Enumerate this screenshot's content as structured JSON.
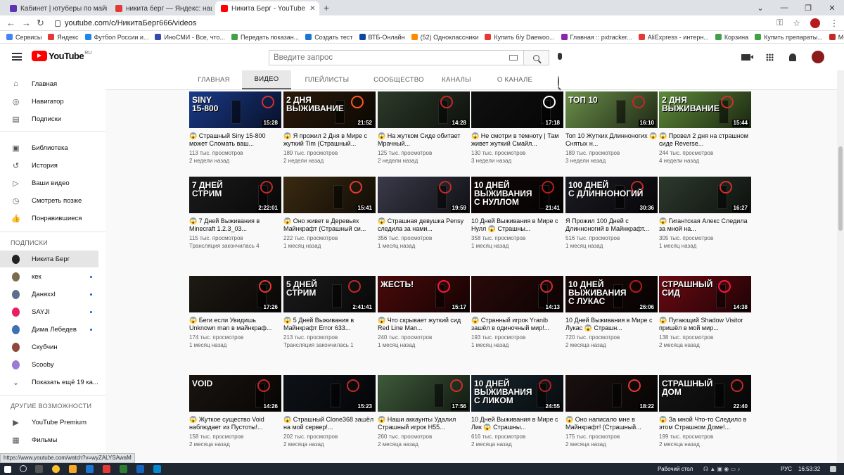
{
  "browser": {
    "tabs": [
      {
        "title": "Кабинет | ютуберы по майнкрафт"
      },
      {
        "title": "никита берг — Яндекс: нашлось"
      },
      {
        "title": "Никита Берг - YouTube"
      }
    ],
    "new_tab": "+",
    "url": "youtube.com/c/НикитаБерг666/videos",
    "bookmarks": [
      {
        "label": "Сервисы",
        "color": "#4285f4"
      },
      {
        "label": "Яндекс",
        "color": "#e53935"
      },
      {
        "label": "Футбол России и...",
        "color": "#1e88e5"
      },
      {
        "label": "ИноСМИ - Все, что...",
        "color": "#3949ab"
      },
      {
        "label": "Передать показан...",
        "color": "#43a047"
      },
      {
        "label": "Создать тест",
        "color": "#1976d2"
      },
      {
        "label": "ВТБ-Онлайн",
        "color": "#0d47a1"
      },
      {
        "label": "(52) Одноклассники",
        "color": "#fb8c00"
      },
      {
        "label": "Купить б/у Daewoo...",
        "color": "#e53935"
      },
      {
        "label": "Главная :: pxtracker...",
        "color": "#8e24aa"
      },
      {
        "label": "AliExpress - интерн...",
        "color": "#e53935"
      },
      {
        "label": "Корзина",
        "color": "#43a047"
      },
      {
        "label": "Купить препараты...",
        "color": "#43a047"
      },
      {
        "label": "Моя учетная запис...",
        "color": "#c62828"
      }
    ]
  },
  "header": {
    "logo": "YouTube",
    "logo_region": "RU",
    "search_placeholder": "Введите запрос"
  },
  "sidebar": {
    "main": [
      {
        "label": "Главная",
        "icon": "home-icon",
        "glyph": "⌂"
      },
      {
        "label": "Навигатор",
        "icon": "compass-icon",
        "glyph": "◎"
      },
      {
        "label": "Подписки",
        "icon": "subscriptions-icon",
        "glyph": "▤"
      }
    ],
    "library": [
      {
        "label": "Библиотека",
        "icon": "library-icon",
        "glyph": "▣"
      },
      {
        "label": "История",
        "icon": "history-icon",
        "glyph": "↺"
      },
      {
        "label": "Ваши видео",
        "icon": "your-videos-icon",
        "glyph": "▷"
      },
      {
        "label": "Смотреть позже",
        "icon": "watch-later-icon",
        "glyph": "◷"
      },
      {
        "label": "Понравившиеся",
        "icon": "like-icon",
        "glyph": "👍"
      }
    ],
    "subs_heading": "ПОДПИСКИ",
    "subs": [
      {
        "label": "Никита Берг",
        "color": "#222",
        "dot": false,
        "selected": true
      },
      {
        "label": "кек",
        "color": "#7a6a4f",
        "dot": true
      },
      {
        "label": "Даняxxl",
        "color": "#5b6f8a",
        "dot": true
      },
      {
        "label": "SAYJI",
        "color": "#e91e63",
        "dot": true
      },
      {
        "label": "Дима Лебедев",
        "color": "#3f6fb5",
        "dot": true
      },
      {
        "label": "Скубчин",
        "color": "#8d4a3a",
        "dot": false
      },
      {
        "label": "Scooby",
        "color": "#9c7bd6",
        "dot": false
      }
    ],
    "show_more": "Показать ещё 19 ка...",
    "other_heading": "ДРУГИЕ ВОЗМОЖНОСТИ",
    "other": [
      {
        "label": "YouTube Premium",
        "icon": "youtube-premium-icon",
        "glyph": "▶"
      },
      {
        "label": "Фильмы",
        "icon": "films-icon",
        "glyph": "▦"
      }
    ]
  },
  "channel_tabs": [
    {
      "label": "ГЛАВНАЯ"
    },
    {
      "label": "ВИДЕО",
      "selected": true
    },
    {
      "label": "ПЛЕЙЛИСТЫ"
    },
    {
      "label": "СООБЩЕСТВО"
    },
    {
      "label": "КАНАЛЫ"
    },
    {
      "label": "О КАНАЛЕ"
    }
  ],
  "videos": [
    {
      "title": "😱 Страшный Siny 15-800 может Сломать ваш...",
      "views": "113 тыс. просмотров",
      "age": "2 недели назад",
      "duration": "15:28",
      "overlay": "SINY\n15-800",
      "bg": "#1a3a8a",
      "accent": "#d32f2f"
    },
    {
      "title": "😱 Я прожил 2 Дня в Мире с жуткий Tim (Страшный...",
      "views": "189 тыс. просмотров",
      "age": "2 недели назад",
      "duration": "21:52",
      "overlay": "2 ДНЯ\nВЫЖИВАНИЕ",
      "bg": "#2a1a0a",
      "accent": "#ff5722"
    },
    {
      "title": "😱 На жутком Сиде обитает Мрачный...",
      "views": "125 тыс. просмотров",
      "age": "2 недели назад",
      "duration": "14:28",
      "overlay": "",
      "bg": "#2d3a2a",
      "accent": "#c62828"
    },
    {
      "title": "😱 Не смотри в темноту | Там живет жуткий Смайл...",
      "views": "130 тыс. просмотров",
      "age": "3 недели назад",
      "duration": "17:18",
      "overlay": "",
      "bg": "#111111",
      "accent": "#ffffff"
    },
    {
      "title": "Топ 10 Жутких Длинноногих 😱 Снятых н...",
      "views": "189 тыс. просмотров",
      "age": "3 недели назад",
      "duration": "16:10",
      "overlay": "ТОП 10",
      "bg": "#6b8f4a",
      "accent": "#c62828"
    },
    {
      "title": "😱 Провел 2 дня на страшном сиде Reverse...",
      "views": "244 тыс. просмотров",
      "age": "4 недели назад",
      "duration": "15:44",
      "overlay": "2 ДНЯ\nВЫЖИВАНИЕ",
      "bg": "#5e8a3a",
      "accent": "#d32f2f"
    },
    {
      "title": "😱 7 Дней Выживания в Minecraft 1.2.3_03...",
      "views": "115 тыс. просмотров",
      "age": "Трансляция закончилась 4",
      "duration": "2:22:01",
      "overlay": "7 ДНЕЙ\nСТРИМ",
      "bg": "#1b1b1b",
      "accent": "#c62828"
    },
    {
      "title": "😱 Оно живет в Деревьях Майнкрафт (Страшный си...",
      "views": "222 тыс. просмотров",
      "age": "1 месяц назад",
      "duration": "15:41",
      "overlay": "",
      "bg": "#3a2a12",
      "accent": "#e53935"
    },
    {
      "title": "😱 Страшная девушка Pensy следила за нами...",
      "views": "356 тыс. просмотров",
      "age": "1 месяц назад",
      "duration": "19:59",
      "overlay": "",
      "bg": "#3a3a4a",
      "accent": "#c62828"
    },
    {
      "title": "10 Дней Выживания в Мире с Нулл 😱 Страшны...",
      "views": "358 тыс. просмотров",
      "age": "1 месяц назад",
      "duration": "21:41",
      "overlay": "10 ДНЕЙ\nВЫЖИВАНИЯ\nС НУЛЛОМ",
      "bg": "#120808",
      "accent": "#b71c1c"
    },
    {
      "title": "Я Прожил 100 Дней с Длинноногий в Майнкрафт...",
      "views": "516 тыс. просмотров",
      "age": "1 месяц назад",
      "duration": "30:36",
      "overlay": "100 ДНЕЙ\nС ДЛИННОНОГИЙ",
      "bg": "#1a1a22",
      "accent": "#c62828"
    },
    {
      "title": "😱 Гигантская Алекс Следила за мной на...",
      "views": "305 тыс. просмотров",
      "age": "1 месяц назад",
      "duration": "16:27",
      "overlay": "",
      "bg": "#2e3a2e",
      "accent": "#d32f2f"
    },
    {
      "title": "😱 Беги если Увидишь Unknown man в майнкраф...",
      "views": "174 тыс. просмотров",
      "age": "1 месяц назад",
      "duration": "17:26",
      "overlay": "",
      "bg": "#1e1a14",
      "accent": "#e53935"
    },
    {
      "title": "😱 5 Дней Выживания в Майнкрафт Error 633...",
      "views": "213 тыс. просмотров",
      "age": "Трансляция закончилась 1",
      "duration": "2:41:41",
      "overlay": "5 ДНЕЙ\nСТРИМ",
      "bg": "#1b1b1b",
      "accent": "#c62828"
    },
    {
      "title": "😱 Что скрывает жуткий сид Red Line Man...",
      "views": "240 тыс. просмотров",
      "age": "1 месяц назад",
      "duration": "15:17",
      "overlay": "ЖЕСТЬ!",
      "bg": "#4a0a0a",
      "accent": "#ff1744"
    },
    {
      "title": "😱 Странный игрок Yranib зашёл в одиночный мир!...",
      "views": "193 тыс. просмотров",
      "age": "1 месяц назад",
      "duration": "14:13",
      "overlay": "",
      "bg": "#2a0a0a",
      "accent": "#d32f2f"
    },
    {
      "title": "10 Дней Выживания в Мире с Лукас 😱 Страшн...",
      "views": "720 тыс. просмотров",
      "age": "2 месяца назад",
      "duration": "26:06",
      "overlay": "10 ДНЕЙ\nВЫЖИВАНИЯ\nС ЛУКАС",
      "bg": "#1a0808",
      "accent": "#b71c1c"
    },
    {
      "title": "😱 Пугающий Shadow Visitor пришёл в мой мир...",
      "views": "138 тыс. просмотров",
      "age": "2 месяца назад",
      "duration": "14:38",
      "overlay": "СТРАШНЫЙ\nСИД",
      "bg": "#6a0a12",
      "accent": "#ff1744"
    },
    {
      "title": "😱 Жуткое существо Void наблюдает из Пустоты!...",
      "views": "158 тыс. просмотров",
      "age": "2 месяца назад",
      "duration": "14:26",
      "overlay": "VOID",
      "bg": "#1a1410",
      "accent": "#c62828"
    },
    {
      "title": "😱 Страшный Clone368 зашёл на мой сервер!...",
      "views": "202 тыс. просмотров",
      "age": "2 месяца назад",
      "duration": "15:23",
      "overlay": "",
      "bg": "#0e1218",
      "accent": "#c62828"
    },
    {
      "title": "😱 Наши аккаунты Удалил Страшный игрок H55...",
      "views": "260 тыс. просмотров",
      "age": "2 месяца назад",
      "duration": "17:56",
      "overlay": "",
      "bg": "#3e5a3a",
      "accent": "#d32f2f"
    },
    {
      "title": "10 Дней Выживания в Мире с Лик 😱 Страшны...",
      "views": "616 тыс. просмотров",
      "age": "2 месяца назад",
      "duration": "24:55",
      "overlay": "10 ДНЕЙ\nВЫЖИВАНИЯ\nС ЛИКОМ",
      "bg": "#18262e",
      "accent": "#b71c1c"
    },
    {
      "title": "😱 Оно написало мне в Майнкрафт! (Страшный...",
      "views": "175 тыс. просмотров",
      "age": "2 месяца назад",
      "duration": "18:22",
      "overlay": "",
      "bg": "#1a1010",
      "accent": "#e53935"
    },
    {
      "title": "😱 За мной Что-то Следило в этом Страшном Доме!...",
      "views": "199 тыс. просмотров",
      "age": "2 месяца назад",
      "duration": "22:40",
      "overlay": "СТРАШНЫЙ\nДОМ",
      "bg": "#151515",
      "accent": "#c62828"
    }
  ],
  "status_url": "https://www.youtube.com/watch?v=wyZALYSAwaM",
  "taskbar": {
    "desktop": "Рабочий стол",
    "lang": "РУС",
    "time": "16:53:32"
  }
}
